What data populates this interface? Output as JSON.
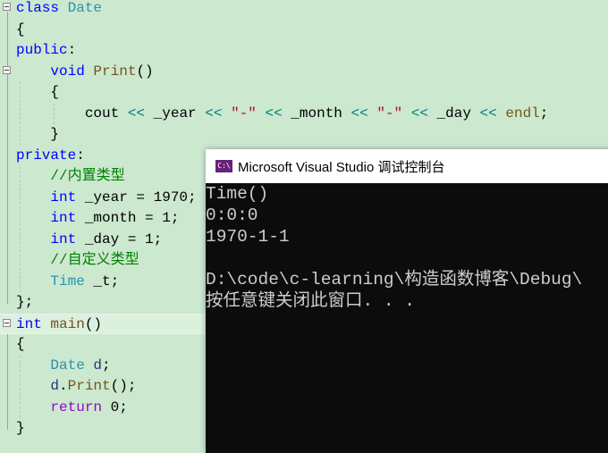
{
  "editor": {
    "lines": [
      [
        [
          "kw",
          "class "
        ],
        [
          "ty",
          "Date"
        ]
      ],
      [
        [
          "pl",
          "{"
        ]
      ],
      [
        [
          "kw",
          "public"
        ],
        [
          "pl",
          ":"
        ]
      ],
      [
        [
          "pl",
          "    "
        ],
        [
          "kw",
          "void "
        ],
        [
          "fn",
          "Print"
        ],
        [
          "pl",
          "()"
        ]
      ],
      [
        [
          "pl",
          "    {"
        ]
      ],
      [
        [
          "pl",
          "        cout "
        ],
        [
          "op",
          "<< "
        ],
        [
          "pl",
          "_year "
        ],
        [
          "op",
          "<< "
        ],
        [
          "st",
          "\"-\" "
        ],
        [
          "op",
          "<< "
        ],
        [
          "pl",
          "_month "
        ],
        [
          "op",
          "<< "
        ],
        [
          "st",
          "\"-\" "
        ],
        [
          "op",
          "<< "
        ],
        [
          "pl",
          "_day "
        ],
        [
          "op",
          "<< "
        ],
        [
          "fn",
          "endl"
        ],
        [
          "pl",
          ";"
        ]
      ],
      [
        [
          "pl",
          "    }"
        ]
      ],
      [
        [
          "kw",
          "private"
        ],
        [
          "pl",
          ":"
        ]
      ],
      [
        [
          "pl",
          "    "
        ],
        [
          "cm",
          "//内置类型"
        ]
      ],
      [
        [
          "pl",
          "    "
        ],
        [
          "kw",
          "int "
        ],
        [
          "pl",
          "_year = 1970;"
        ]
      ],
      [
        [
          "pl",
          "    "
        ],
        [
          "kw",
          "int "
        ],
        [
          "pl",
          "_month = 1;"
        ]
      ],
      [
        [
          "pl",
          "    "
        ],
        [
          "kw",
          "int "
        ],
        [
          "pl",
          "_day = 1;"
        ]
      ],
      [
        [
          "pl",
          "    "
        ],
        [
          "cm",
          "//自定义类型"
        ]
      ],
      [
        [
          "pl",
          "    "
        ],
        [
          "ty",
          "Time "
        ],
        [
          "pl",
          "_t;"
        ]
      ],
      [
        [
          "pl",
          "};"
        ]
      ],
      [
        [
          "kw",
          "int "
        ],
        [
          "fn",
          "main"
        ],
        [
          "pl",
          "()"
        ]
      ],
      [
        [
          "pl",
          "{"
        ]
      ],
      [
        [
          "pl",
          "    "
        ],
        [
          "ty",
          "Date "
        ],
        [
          "va",
          "d"
        ],
        [
          "pl",
          ";"
        ]
      ],
      [
        [
          "pl",
          "    "
        ],
        [
          "va",
          "d"
        ],
        [
          "pl",
          "."
        ],
        [
          "fn",
          "Print"
        ],
        [
          "pl",
          "();"
        ]
      ],
      [
        [
          "pl",
          "    "
        ],
        [
          "ct",
          "return "
        ],
        [
          "nm",
          "0"
        ],
        [
          "pl",
          ";"
        ]
      ],
      [
        [
          "pl",
          "}"
        ]
      ]
    ]
  },
  "console": {
    "icon_label": "C:\\",
    "title": "Microsoft Visual Studio 调试控制台",
    "output": [
      "Time()",
      "0:0:0",
      "1970-1-1",
      "",
      "D:\\code\\c-learning\\构造函数博客\\Debug\\",
      "按任意键关闭此窗口. . ."
    ]
  }
}
